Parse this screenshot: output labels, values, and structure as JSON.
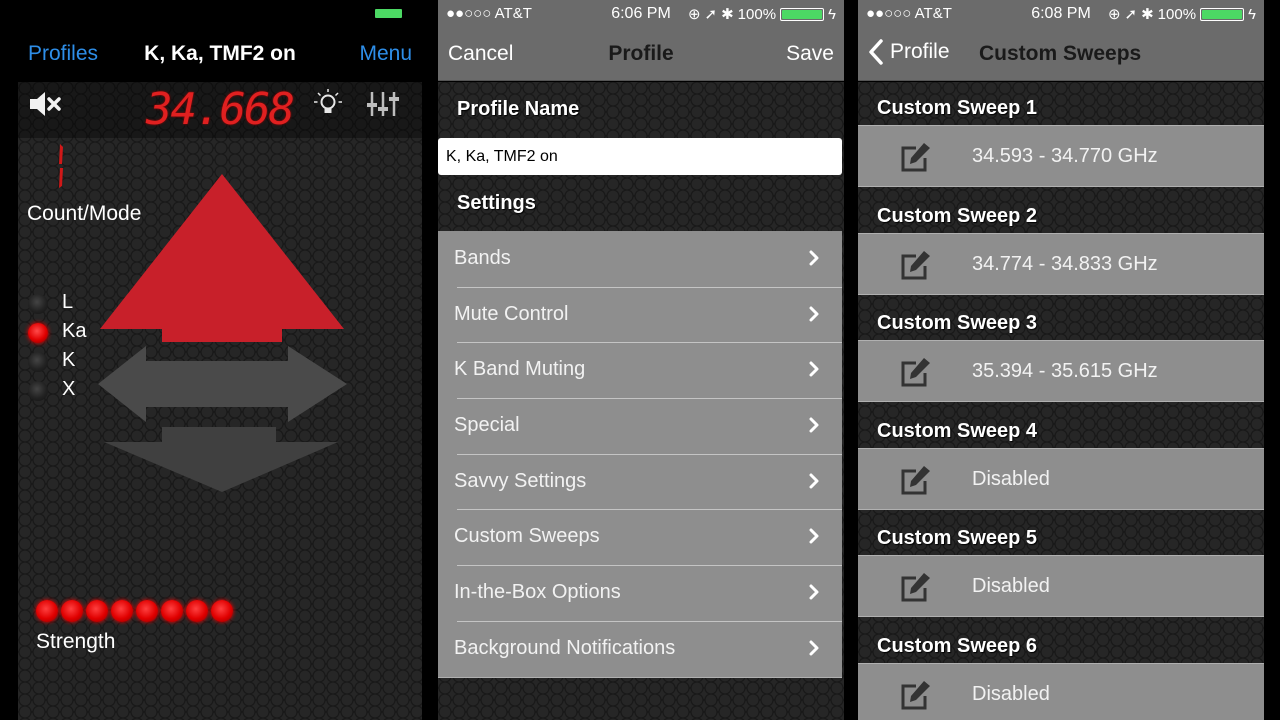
{
  "detector": {
    "nav": {
      "left": "Profiles",
      "title": "K, Ka, TMF2 on",
      "right": "Menu"
    },
    "frequency": "34.668",
    "count_digit": "1",
    "count_label": "Count/Mode",
    "bands": [
      {
        "label": "L",
        "active": false
      },
      {
        "label": "Ka",
        "active": true
      },
      {
        "label": "K",
        "active": false
      },
      {
        "label": "X",
        "active": false
      }
    ],
    "direction": "front",
    "strength": {
      "lit": 8,
      "label": "Strength"
    },
    "colors": {
      "accent": "#2e8ee8",
      "alert": "#e02020",
      "arrow_active": "#c8202a",
      "arrow_inactive": "#4a4a4a"
    }
  },
  "profile": {
    "status": {
      "carrier": "●●○○○ AT&T",
      "time": "6:06 PM",
      "battery": "100%"
    },
    "nav": {
      "left": "Cancel",
      "title": "Profile",
      "right": "Save"
    },
    "name_section": "Profile Name",
    "name_value": "K, Ka, TMF2 on",
    "settings_section": "Settings",
    "items": [
      "Bands",
      "Mute Control",
      "K Band Muting",
      "Special",
      "Savvy Settings",
      "Custom Sweeps",
      "In-the-Box Options",
      "Background Notifications"
    ]
  },
  "sweeps": {
    "status": {
      "carrier": "●●○○○ AT&T",
      "time": "6:08 PM",
      "battery": "100%"
    },
    "nav": {
      "back": "Profile",
      "title": "Custom Sweeps"
    },
    "items": [
      {
        "title": "Custom Sweep 1",
        "value": "34.593 - 34.770 GHz"
      },
      {
        "title": "Custom Sweep 2",
        "value": "34.774 - 34.833 GHz"
      },
      {
        "title": "Custom Sweep 3",
        "value": "35.394 - 35.615 GHz"
      },
      {
        "title": "Custom Sweep 4",
        "value": "Disabled"
      },
      {
        "title": "Custom Sweep 5",
        "value": "Disabled"
      },
      {
        "title": "Custom Sweep 6",
        "value": "Disabled"
      }
    ]
  }
}
